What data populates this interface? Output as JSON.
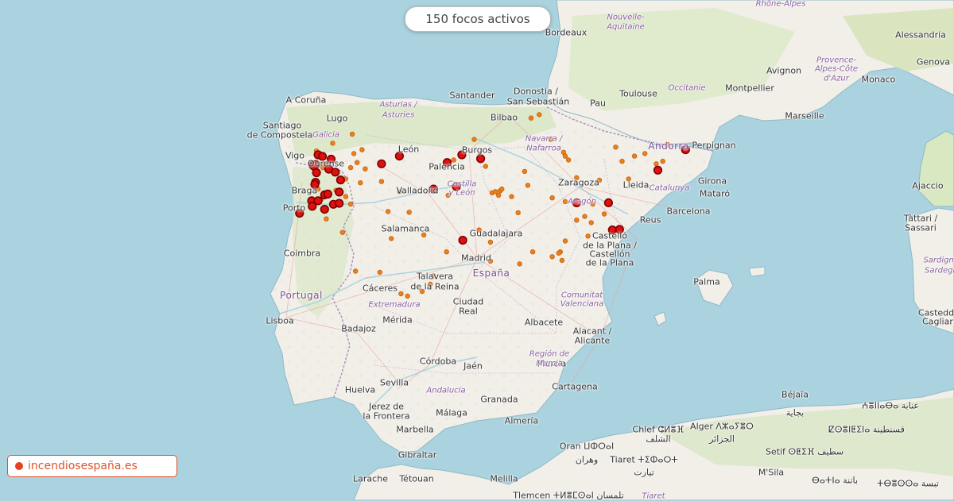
{
  "counter": {
    "text": "150 focos activos"
  },
  "credit": {
    "text": "incendiosespaña.es",
    "dot_color": "#e8401c"
  },
  "colors": {
    "sea": "#aad3df",
    "land": "#f2efe9",
    "green": "#d3e6b5",
    "fire_major": "#e01010",
    "fire_minor": "#e8801c"
  },
  "labels": {
    "cities": [
      {
        "id": "bordeaux",
        "text": "Bordeaux"
      },
      {
        "id": "toulouse",
        "text": "Toulouse"
      },
      {
        "id": "montpellier",
        "text": "Montpellier"
      },
      {
        "id": "avignon",
        "text": "Avignon"
      },
      {
        "id": "marseille",
        "text": "Marseille"
      },
      {
        "id": "monaco",
        "text": "Monaco"
      },
      {
        "id": "genova",
        "text": "Genova"
      },
      {
        "id": "alessandria",
        "text": "Alessandria"
      },
      {
        "id": "perpignan",
        "text": "Perpignan"
      },
      {
        "id": "pau",
        "text": "Pau"
      },
      {
        "id": "santander",
        "text": "Santander"
      },
      {
        "id": "donostia",
        "text": "Donostia /"
      },
      {
        "id": "sansebastian",
        "text": "San Sebastián"
      },
      {
        "id": "bilbao",
        "text": "Bilbao"
      },
      {
        "id": "acoruna",
        "text": "A Coruña"
      },
      {
        "id": "santiago1",
        "text": "Santiago"
      },
      {
        "id": "santiago2",
        "text": "de Compostela"
      },
      {
        "id": "lugo",
        "text": "Lugo"
      },
      {
        "id": "vigo",
        "text": "Vigo"
      },
      {
        "id": "ourense",
        "text": "Ourense"
      },
      {
        "id": "leon",
        "text": "León"
      },
      {
        "id": "burgos",
        "text": "Burgos"
      },
      {
        "id": "palencia",
        "text": "Palencia"
      },
      {
        "id": "braga",
        "text": "Braga"
      },
      {
        "id": "porto",
        "text": "Porto"
      },
      {
        "id": "valladolid",
        "text": "Valladolid"
      },
      {
        "id": "zaragoza",
        "text": "Zaragoza"
      },
      {
        "id": "lleida",
        "text": "Lleida"
      },
      {
        "id": "girona",
        "text": "Girona"
      },
      {
        "id": "mataro",
        "text": "Mataró"
      },
      {
        "id": "barcelona",
        "text": "Barcelona"
      },
      {
        "id": "reus",
        "text": "Reus"
      },
      {
        "id": "salamanca",
        "text": "Salamanca"
      },
      {
        "id": "guadalajara",
        "text": "Guadalajara"
      },
      {
        "id": "madrid",
        "text": "Madrid"
      },
      {
        "id": "coimbra",
        "text": "Coimbra"
      },
      {
        "id": "castello1",
        "text": "Castelló"
      },
      {
        "id": "castello2",
        "text": "de la Plana /"
      },
      {
        "id": "castello3",
        "text": "Castellón"
      },
      {
        "id": "castello4",
        "text": "de la Plana"
      },
      {
        "id": "talavera1",
        "text": "Talavera"
      },
      {
        "id": "talavera2",
        "text": "de la Reina"
      },
      {
        "id": "caceres",
        "text": "Cáceres"
      },
      {
        "id": "palma",
        "text": "Palma"
      },
      {
        "id": "ciudadreal1",
        "text": "Ciudad"
      },
      {
        "id": "ciudadreal2",
        "text": "Real"
      },
      {
        "id": "lisboa",
        "text": "Lisboa"
      },
      {
        "id": "badajoz",
        "text": "Badajoz"
      },
      {
        "id": "merida",
        "text": "Mérida"
      },
      {
        "id": "albacete",
        "text": "Albacete"
      },
      {
        "id": "alacant1",
        "text": "Alacant /"
      },
      {
        "id": "alacant2",
        "text": "Alicante"
      },
      {
        "id": "cordoba",
        "text": "Córdoba"
      },
      {
        "id": "jaen",
        "text": "Jaén"
      },
      {
        "id": "murcia",
        "text": "Murcia"
      },
      {
        "id": "cartagena",
        "text": "Cartagena"
      },
      {
        "id": "huelva",
        "text": "Huelva"
      },
      {
        "id": "sevilla",
        "text": "Sevilla"
      },
      {
        "id": "granada",
        "text": "Granada"
      },
      {
        "id": "jerez1",
        "text": "Jerez de"
      },
      {
        "id": "jerez2",
        "text": "la Frontera"
      },
      {
        "id": "malaga",
        "text": "Málaga"
      },
      {
        "id": "almeria",
        "text": "Almería"
      },
      {
        "id": "marbella",
        "text": "Marbella"
      },
      {
        "id": "gibraltar",
        "text": "Gibraltar"
      },
      {
        "id": "larache",
        "text": "Larache"
      },
      {
        "id": "tetouan",
        "text": "Tétouan"
      },
      {
        "id": "melilla",
        "text": "Melilla"
      },
      {
        "id": "oran",
        "text": "Oran ⵡⵀⵔⴰⵏ"
      },
      {
        "id": "oran_ar",
        "text": "وهران"
      },
      {
        "id": "tlemcen",
        "text": "Tlemcen ⵜⵍⴻⵎⵙⴰⵏ تلمسان"
      },
      {
        "id": "chlef",
        "text": "Chlef ⵛⵍⴻⴼ"
      },
      {
        "id": "chlef_ar",
        "text": "الشلف"
      },
      {
        "id": "tiaret",
        "text": "Tiaret ⵜⵉⵀⴰⵔⵜ"
      },
      {
        "id": "tiaret_ar",
        "text": "تيارت"
      },
      {
        "id": "alger",
        "text": "Alger ⴷⵣⴰⵢⴻⵔ"
      },
      {
        "id": "alger_ar",
        "text": "الجزائر"
      },
      {
        "id": "msila",
        "text": "M'Sila"
      },
      {
        "id": "setif",
        "text": "Setif ⵙⵟⵉⴼ سطيف"
      },
      {
        "id": "bejaia",
        "text": "Béjaïa"
      },
      {
        "id": "bejaia_ar",
        "text": "بجاية"
      },
      {
        "id": "constantine",
        "text": "ⵇⵙⴻⵏⵟⵉⵏⴰ قسنطينة"
      },
      {
        "id": "annaba",
        "text": "ⵄⴻⵏⵏⴰⴱⴰ عنابة"
      },
      {
        "id": "batna",
        "text": "ⴱⴰⵜⵏⴰ باتنة"
      },
      {
        "id": "tebessa",
        "text": "ⵜⴱⴻⵙⵙⴰ تبسة"
      },
      {
        "id": "tattari",
        "text": "Tàttari /"
      },
      {
        "id": "sassari",
        "text": "Sassari"
      },
      {
        "id": "ajaccio",
        "text": "Ajaccio"
      },
      {
        "id": "casteddu1",
        "text": "Casteddu"
      },
      {
        "id": "casteddu2",
        "text": "Cagliari"
      }
    ],
    "regions": [
      {
        "id": "nouvelle",
        "text": "Nouvelle-"
      },
      {
        "id": "aquitaine",
        "text": "Aquitaine"
      },
      {
        "id": "occitanie",
        "text": "Occitanie"
      },
      {
        "id": "provence1",
        "text": "Provence-"
      },
      {
        "id": "provence2",
        "text": "Alpes-Côte"
      },
      {
        "id": "provence3",
        "text": "d'Azur"
      },
      {
        "id": "rhone",
        "text": "Rhône-Alpes"
      },
      {
        "id": "asturias1",
        "text": "Asturias /"
      },
      {
        "id": "asturias2",
        "text": "Asturies"
      },
      {
        "id": "galicia",
        "text": "Galicia"
      },
      {
        "id": "navarra1",
        "text": "Navarra /"
      },
      {
        "id": "navarra2",
        "text": "Nafarroa"
      },
      {
        "id": "castilla1",
        "text": "Castilla"
      },
      {
        "id": "castilla2",
        "text": "y León"
      },
      {
        "id": "aragon",
        "text": "Aragón"
      },
      {
        "id": "catalunya",
        "text": "Catalunya"
      },
      {
        "id": "comunitat1",
        "text": "Comunitat"
      },
      {
        "id": "comunitat2",
        "text": "Valenciana"
      },
      {
        "id": "extremadura",
        "text": "Extremadura"
      },
      {
        "id": "andalucia",
        "text": "Andalucía"
      },
      {
        "id": "region1",
        "text": "Región de"
      },
      {
        "id": "region2",
        "text": "Murcia"
      },
      {
        "id": "sardegna1",
        "text": "Sardigna /"
      },
      {
        "id": "sardegna2",
        "text": "Sardegna"
      },
      {
        "id": "tiaret_reg",
        "text": "Tiaret"
      }
    ],
    "countries": [
      {
        "id": "espana",
        "text": "España"
      },
      {
        "id": "portugal",
        "text": "Portugal"
      },
      {
        "id": "andorra",
        "text": "Andorra"
      }
    ]
  },
  "fires": {
    "major": [
      {
        "lon": -8.55,
        "lat": 41.9
      },
      {
        "lon": -8.42,
        "lat": 41.84
      },
      {
        "lon": -8.15,
        "lat": 41.73
      },
      {
        "lon": -8.71,
        "lat": 41.5
      },
      {
        "lon": -8.63,
        "lat": 41.52
      },
      {
        "lon": -8.68,
        "lat": 41.46
      },
      {
        "lon": -8.22,
        "lat": 41.34
      },
      {
        "lon": -8.02,
        "lat": 41.22
      },
      {
        "lon": -8.6,
        "lat": 41.2
      },
      {
        "lon": -7.86,
        "lat": 40.91
      },
      {
        "lon": -8.63,
        "lat": 40.82
      },
      {
        "lon": -8.65,
        "lat": 40.73
      },
      {
        "lon": -8.35,
        "lat": 40.32
      },
      {
        "lon": -8.25,
        "lat": 40.35
      },
      {
        "lon": -7.9,
        "lat": 40.43
      },
      {
        "lon": -8.75,
        "lat": 40.08
      },
      {
        "lon": -8.55,
        "lat": 40.08
      },
      {
        "lon": -8.73,
        "lat": 39.86
      },
      {
        "lon": -8.08,
        "lat": 39.94
      },
      {
        "lon": -7.9,
        "lat": 39.98
      },
      {
        "lon": -8.35,
        "lat": 39.74
      },
      {
        "lon": -9.12,
        "lat": 39.58
      },
      {
        "lon": -6.6,
        "lat": 41.55
      },
      {
        "lon": -6.05,
        "lat": 41.85
      },
      {
        "lon": -4.58,
        "lat": 41.6
      },
      {
        "lon": -4.13,
        "lat": 41.9
      },
      {
        "lon": -3.55,
        "lat": 41.75
      },
      {
        "lon": -5.0,
        "lat": 40.55
      },
      {
        "lon": -4.3,
        "lat": 40.65
      },
      {
        "lon": -0.6,
        "lat": 40.0
      },
      {
        "lon": 0.38,
        "lat": 40.0
      },
      {
        "lon": 0.5,
        "lat": 38.9
      },
      {
        "lon": 0.72,
        "lat": 38.92
      },
      {
        "lon": -4.1,
        "lat": 38.48
      },
      {
        "lon": 2.75,
        "lat": 42.1
      },
      {
        "lon": 1.9,
        "lat": 41.3
      }
    ],
    "minor": [
      {
        "lon": -7.5,
        "lat": 42.7
      },
      {
        "lon": -8.6,
        "lat": 42.05
      },
      {
        "lon": -7.2,
        "lat": 42.1
      },
      {
        "lon": -7.45,
        "lat": 41.95
      },
      {
        "lon": -8.4,
        "lat": 41.4
      },
      {
        "lon": -7.35,
        "lat": 41.6
      },
      {
        "lon": -7.55,
        "lat": 41.4
      },
      {
        "lon": -7.1,
        "lat": 41.35
      },
      {
        "lon": -7.7,
        "lat": 40.95
      },
      {
        "lon": -6.6,
        "lat": 40.85
      },
      {
        "lon": -8.0,
        "lat": 40.5
      },
      {
        "lon": -7.55,
        "lat": 39.95
      },
      {
        "lon": -6.4,
        "lat": 39.65
      },
      {
        "lon": -5.75,
        "lat": 39.62
      },
      {
        "lon": -7.8,
        "lat": 38.8
      },
      {
        "lon": -6.3,
        "lat": 38.55
      },
      {
        "lon": -5.3,
        "lat": 38.7
      },
      {
        "lon": -7.4,
        "lat": 37.2
      },
      {
        "lon": -6.65,
        "lat": 37.15
      },
      {
        "lon": -5.1,
        "lat": 36.65
      },
      {
        "lon": -6.0,
        "lat": 36.25
      },
      {
        "lon": -5.8,
        "lat": 36.15
      },
      {
        "lon": -5.0,
        "lat": 37.0
      },
      {
        "lon": -5.35,
        "lat": 36.35
      },
      {
        "lon": -3.25,
        "lat": 37.62
      },
      {
        "lon": -4.38,
        "lat": 41.7
      },
      {
        "lon": -3.4,
        "lat": 41.45
      },
      {
        "lon": -3.75,
        "lat": 42.5
      },
      {
        "lon": -2.0,
        "lat": 43.32
      },
      {
        "lon": -1.75,
        "lat": 43.45
      },
      {
        "lon": -1.0,
        "lat": 42.0
      },
      {
        "lon": -0.95,
        "lat": 41.85
      },
      {
        "lon": -0.85,
        "lat": 41.7
      },
      {
        "lon": -0.6,
        "lat": 41.0
      },
      {
        "lon": 1.18,
        "lat": 41.85
      },
      {
        "lon": 0.8,
        "lat": 41.65
      },
      {
        "lon": 0.1,
        "lat": 40.9
      },
      {
        "lon": 0.25,
        "lat": 39.55
      },
      {
        "lon": -0.1,
        "lat": 39.95
      },
      {
        "lon": -0.15,
        "lat": 39.2
      },
      {
        "lon": -0.35,
        "lat": 39.45
      },
      {
        "lon": -0.6,
        "lat": 39.3
      },
      {
        "lon": -0.95,
        "lat": 38.45
      },
      {
        "lon": -1.1,
        "lat": 38.0
      },
      {
        "lon": -1.15,
        "lat": 37.95
      },
      {
        "lon": -1.05,
        "lat": 37.65
      },
      {
        "lon": -1.35,
        "lat": 37.8
      },
      {
        "lon": -1.95,
        "lat": 38.0
      },
      {
        "lon": -3.0,
        "lat": 40.3
      },
      {
        "lon": -3.2,
        "lat": 40.4
      },
      {
        "lon": -3.1,
        "lat": 40.45
      },
      {
        "lon": -2.95,
        "lat": 40.48
      },
      {
        "lon": -2.9,
        "lat": 40.55
      },
      {
        "lon": -2.6,
        "lat": 40.25
      },
      {
        "lon": -2.1,
        "lat": 40.7
      },
      {
        "lon": -2.4,
        "lat": 39.6
      },
      {
        "lon": -1.35,
        "lat": 40.2
      },
      {
        "lon": -0.95,
        "lat": 40.05
      },
      {
        "lon": -3.6,
        "lat": 38.9
      },
      {
        "lon": -3.25,
        "lat": 38.4
      },
      {
        "lon": -4.6,
        "lat": 38.0
      },
      {
        "lon": -2.35,
        "lat": 37.5
      },
      {
        "lon": 1.5,
        "lat": 41.95
      },
      {
        "lon": 1.85,
        "lat": 41.55
      },
      {
        "lon": 2.05,
        "lat": 41.65
      },
      {
        "lon": 2.2,
        "lat": 42.3
      },
      {
        "lon": -8.1,
        "lat": 42.35
      },
      {
        "lon": -8.35,
        "lat": 41.55
      },
      {
        "lon": -8.55,
        "lat": 40.55
      },
      {
        "lon": -8.45,
        "lat": 40.15
      },
      {
        "lon": -8.3,
        "lat": 39.35
      },
      {
        "lon": -7.7,
        "lat": 40.25
      },
      {
        "lon": -7.25,
        "lat": 40.8
      },
      {
        "lon": -6.05,
        "lat": 40.45
      },
      {
        "lon": -4.55,
        "lat": 40.3
      },
      {
        "lon": -2.2,
        "lat": 41.25
      },
      {
        "lon": -1.4,
        "lat": 42.5
      },
      {
        "lon": 0.6,
        "lat": 42.2
      },
      {
        "lon": 1.0,
        "lat": 40.95
      },
      {
        "lon": -0.25,
        "lat": 38.65
      }
    ]
  }
}
